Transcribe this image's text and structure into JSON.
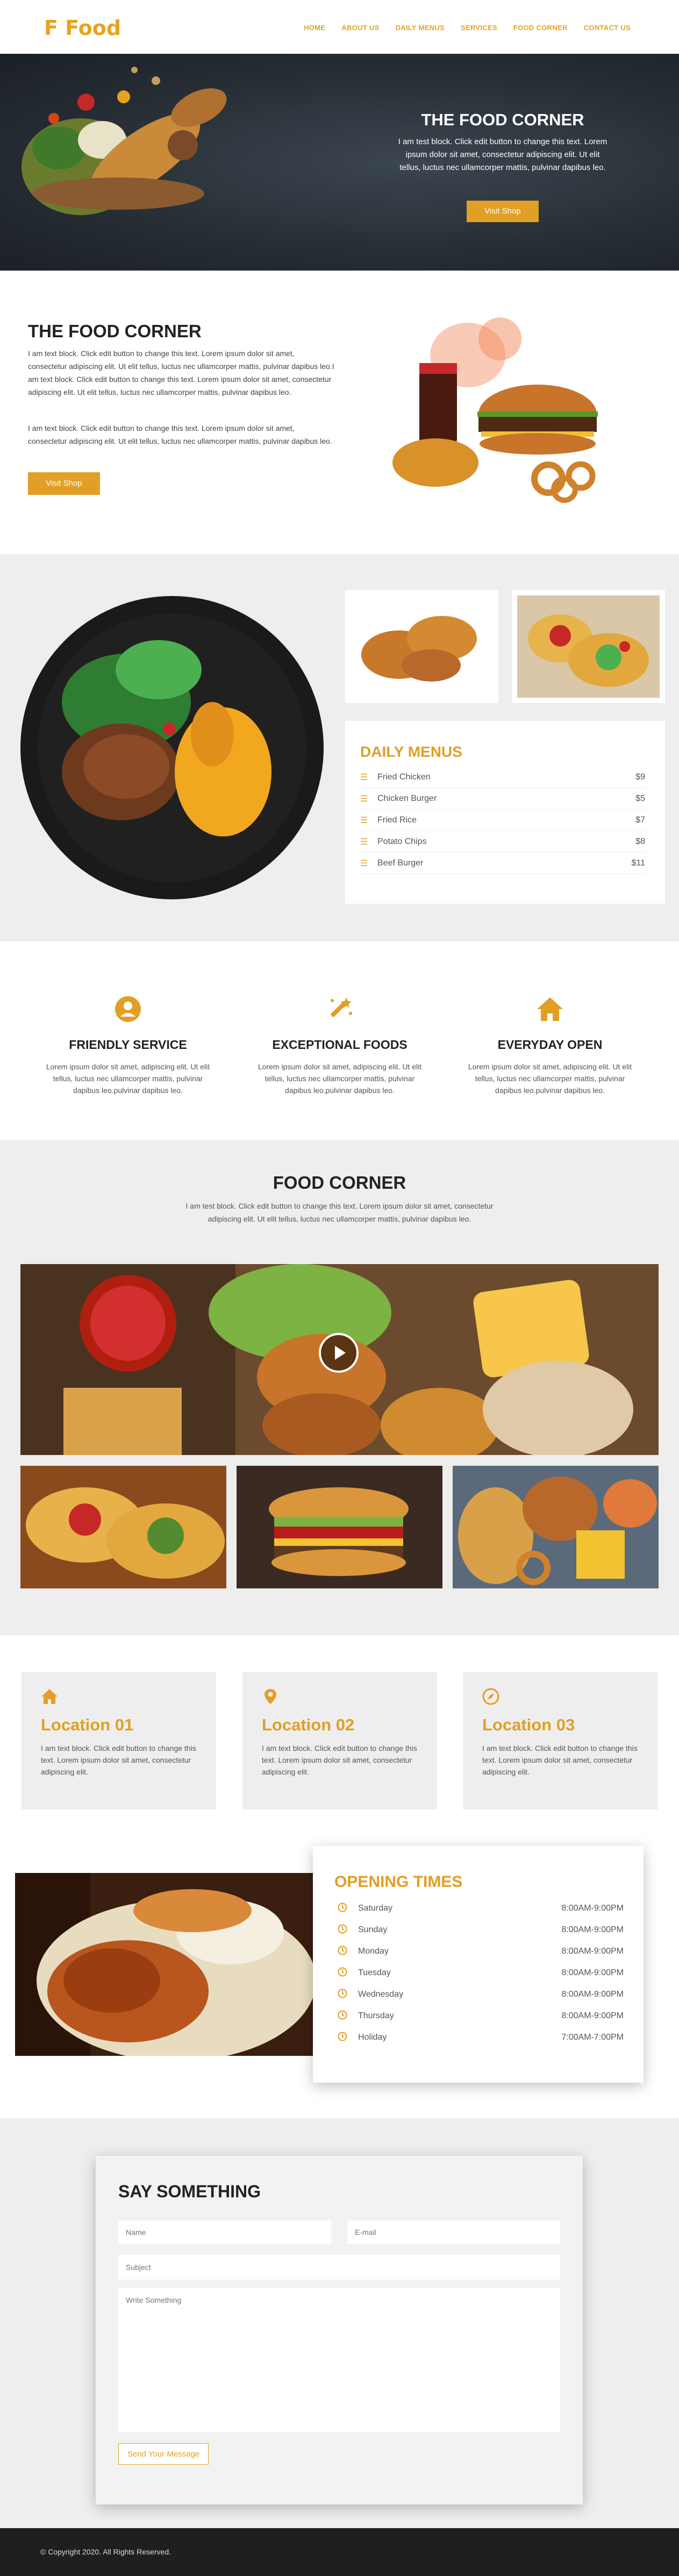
{
  "brand": {
    "name": "F Food",
    "accent": "#e19f25"
  },
  "nav": {
    "items": [
      "HOME",
      "ABOUT US",
      "DAILY MENUS",
      "SERVICES",
      "FOOD CORNER",
      "CONTACT US"
    ]
  },
  "hero": {
    "title": "THE FOOD CORNER",
    "text": "I am test block. Click edit button to change this text. Lorem ipsum dolor sit amet, consectetur adipiscing elit. Ut elit tellus, luctus nec ullamcorper mattis, pulvinar dapibus leo.",
    "button": "Visit Shop"
  },
  "intro": {
    "title": "THE FOOD CORNER",
    "text1": "I am text block. Click edit button to change this text. Lorem ipsum dolor sit amet, consectetur adipiscing elit. Ut elit tellus, luctus nec ullamcorper mattis, pulvinar dapibus leo.I am text block. Click edit button to change this text. Lorem ipsum dolor sit amet, consectetur adipiscing elit. Ut elit tellus, luctus nec ullamcorper mattis, pulvinar dapibus leo.",
    "text2": "I am text block. Click edit button to change this text. Lorem ipsum dolor sit amet, consectetur adipiscing elit. Ut elit tellus, luctus nec ullamcorper mattis, pulvinar dapibus leo.",
    "button": "Visit Shop"
  },
  "menu": {
    "title": "DAILY MENUS",
    "items": [
      {
        "name": "Fried Chicken",
        "price": "$9"
      },
      {
        "name": "Chicken Burger",
        "price": "$5"
      },
      {
        "name": "Fried Rice",
        "price": "$7"
      },
      {
        "name": "Potato Chips",
        "price": "$8"
      },
      {
        "name": "Beef Burger",
        "price": "$11"
      }
    ]
  },
  "features": [
    {
      "icon": "user-icon",
      "title": "FRIENDLY SERVICE",
      "text": "Lorem ipsum dolor sit amet, adipiscing elit. Ut elit tellus, luctus nec ullamcorper mattis, pulvinar dapibus leo.pulvinar dapibus leo."
    },
    {
      "icon": "magic-wand-icon",
      "title": "EXCEPTIONAL FOODS",
      "text": "Lorem ipsum dolor sit amet, adipiscing elit. Ut elit tellus, luctus nec ullamcorper mattis, pulvinar dapibus leo.pulvinar dapibus leo."
    },
    {
      "icon": "home-icon",
      "title": "EVERYDAY OPEN",
      "text": "Lorem ipsum dolor sit amet, adipiscing elit. Ut elit tellus, luctus nec ullamcorper mattis, pulvinar dapibus leo.pulvinar dapibus leo."
    }
  ],
  "food_corner": {
    "title": "FOOD CORNER",
    "text": "I am test block. Click edit button to change this text. Lorem ipsum dolor sit amet, consectetur adipiscing elit. Ut elit tellus, luctus nec ullamcorper mattis, pulvinar dapibus leo."
  },
  "locations": [
    {
      "icon": "home-icon",
      "name": "Location 01",
      "text": "I am text block. Click edit button to change this text. Lorem ipsum dolor sit amet, consectetur adipiscing elit."
    },
    {
      "icon": "map-pin-icon",
      "name": "Location 02",
      "text": "I am text block. Click edit button to change this text. Lorem ipsum dolor sit amet, consectetur adipiscing elit."
    },
    {
      "icon": "compass-icon",
      "name": "Location 03",
      "text": "I am text block. Click edit button to change this text. Lorem ipsum dolor sit amet, consectetur adipiscing elit."
    }
  ],
  "hours": {
    "title": "OPENING TIMES",
    "rows": [
      {
        "day": "Saturday",
        "time": "8:00AM-9:00PM"
      },
      {
        "day": "Sunday",
        "time": "8:00AM-9:00PM"
      },
      {
        "day": "Monday",
        "time": "8:00AM-9:00PM"
      },
      {
        "day": "Tuesday",
        "time": "8:00AM-9:00PM"
      },
      {
        "day": "Wednesday",
        "time": "8:00AM-9:00PM"
      },
      {
        "day": "Thursday",
        "time": "8:00AM-9:00PM"
      },
      {
        "day": "Holiday",
        "time": "7:00AM-7:00PM"
      }
    ]
  },
  "contact": {
    "title": "SAY SOMETHING",
    "name_placeholder": "Name",
    "email_placeholder": "E-mail",
    "subject_placeholder": "Subject",
    "message_placeholder": "Write Something",
    "button": "Send Your Message"
  },
  "footer": {
    "copyright": "© Copyright 2020. All Rights Reserved."
  }
}
